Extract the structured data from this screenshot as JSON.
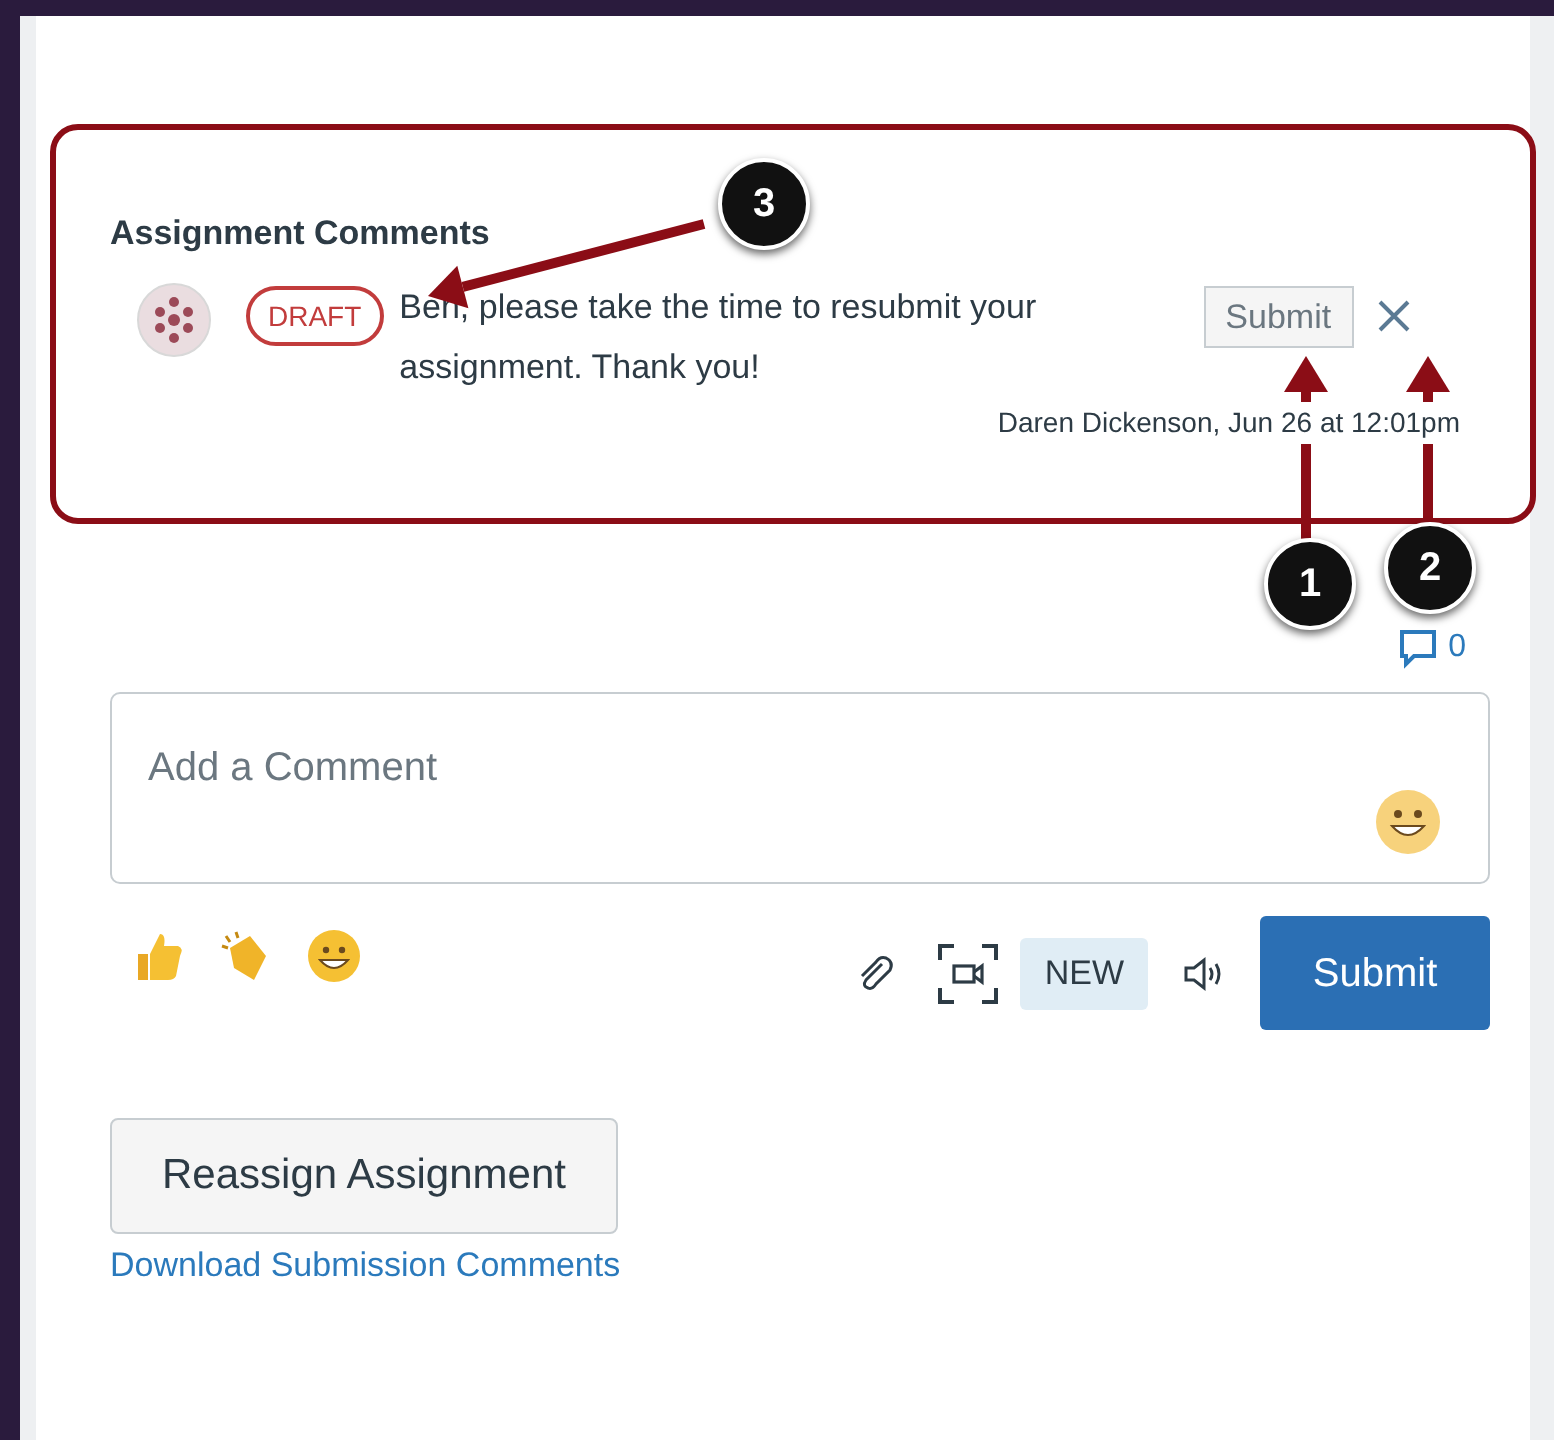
{
  "comments_section": {
    "title": "Assignment Comments",
    "draft_comment": {
      "badge": "DRAFT",
      "text": "Ben, please take the time to resubmit your assignment. Thank you!",
      "submit_label": "Submit",
      "meta": "Daren Dickenson, Jun 26 at 12:01pm"
    }
  },
  "comment_count": "0",
  "comment_field": {
    "placeholder": "Add a Comment"
  },
  "toolbar": {
    "new_badge": "NEW",
    "submit_label": "Submit"
  },
  "reassign_button": "Reassign Assignment",
  "download_link": "Download Submission Comments",
  "callouts": [
    {
      "number": "3"
    },
    {
      "number": "1"
    },
    {
      "number": "2"
    }
  ]
}
